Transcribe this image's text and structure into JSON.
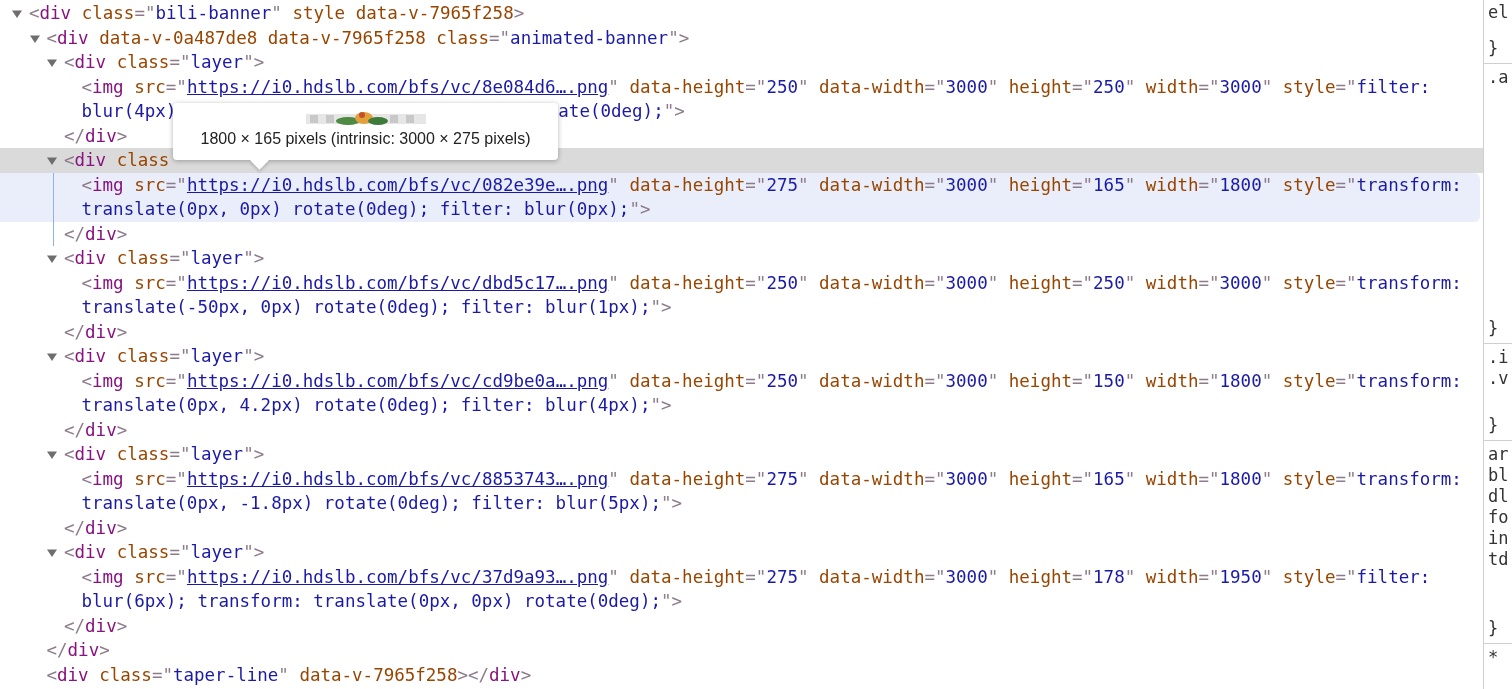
{
  "tree": [
    {
      "lines": [
        [
          {
            "kind": "punct",
            "text": "<"
          },
          {
            "kind": "tag",
            "text": "div"
          },
          {
            "kind": "attr",
            "text": " class"
          },
          {
            "kind": "punct",
            "text": "=\""
          },
          {
            "kind": "value",
            "text": "bili-banner"
          },
          {
            "kind": "punct",
            "text": "\""
          },
          {
            "kind": "attr",
            "text": " style data-v-7965f258"
          },
          {
            "kind": "punct",
            "text": ">"
          }
        ]
      ],
      "expanded": true,
      "selected": false,
      "hovered": false,
      "children": [
        {
          "lines": [
            [
              {
                "kind": "punct",
                "text": "<"
              },
              {
                "kind": "tag",
                "text": "div"
              },
              {
                "kind": "attr",
                "text": " data-v-0a487de8 data-v-7965f258 class"
              },
              {
                "kind": "punct",
                "text": "=\""
              },
              {
                "kind": "value",
                "text": "animated-banner"
              },
              {
                "kind": "punct",
                "text": "\">"
              }
            ]
          ],
          "expanded": true,
          "selected": false,
          "hovered": false,
          "children": [
            {
              "lines": [
                [
                  {
                    "kind": "punct",
                    "text": "<"
                  },
                  {
                    "kind": "tag",
                    "text": "div"
                  },
                  {
                    "kind": "attr",
                    "text": " class"
                  },
                  {
                    "kind": "punct",
                    "text": "=\""
                  },
                  {
                    "kind": "value",
                    "text": "layer"
                  },
                  {
                    "kind": "punct",
                    "text": "\">"
                  }
                ]
              ],
              "expanded": true,
              "selected": false,
              "hovered": false,
              "children": [
                {
                  "lines": [
                    [
                      {
                        "kind": "punct",
                        "text": "<"
                      },
                      {
                        "kind": "tag",
                        "text": "img"
                      },
                      {
                        "kind": "attr",
                        "text": " src"
                      },
                      {
                        "kind": "punct",
                        "text": "=\""
                      },
                      {
                        "kind": "link",
                        "text": "https://i0.hdslb.com/bfs/vc/8e084d6….png"
                      },
                      {
                        "kind": "punct",
                        "text": "\""
                      },
                      {
                        "kind": "attr",
                        "text": " data-height"
                      },
                      {
                        "kind": "punct",
                        "text": "=\""
                      },
                      {
                        "kind": "value",
                        "text": "250"
                      },
                      {
                        "kind": "punct",
                        "text": "\""
                      },
                      {
                        "kind": "attr",
                        "text": " data-width"
                      },
                      {
                        "kind": "punct",
                        "text": "=\""
                      },
                      {
                        "kind": "value",
                        "text": "3000"
                      },
                      {
                        "kind": "punct",
                        "text": "\""
                      },
                      {
                        "kind": "attr",
                        "text": " height"
                      },
                      {
                        "kind": "punct",
                        "text": "=\""
                      },
                      {
                        "kind": "value",
                        "text": "250"
                      },
                      {
                        "kind": "punct",
                        "text": "\""
                      },
                      {
                        "kind": "attr",
                        "text": " width"
                      },
                      {
                        "kind": "punct",
                        "text": "=\""
                      },
                      {
                        "kind": "value",
                        "text": "3000"
                      },
                      {
                        "kind": "punct",
                        "text": "\""
                      },
                      {
                        "kind": "attr",
                        "text": " style"
                      },
                      {
                        "kind": "punct",
                        "text": "=\""
                      },
                      {
                        "kind": "value",
                        "text": "filter:"
                      }
                    ],
                    [
                      {
                        "kind": "value",
                        "text": "blur(4px)"
                      },
                      {
                        "kind": "after-cover",
                        "text": "ate(0deg);"
                      },
                      {
                        "kind": "punct",
                        "text": "\">"
                      }
                    ]
                  ],
                  "selected": false,
                  "hovered": false
                }
              ],
              "close": [
                {
                  "kind": "punct",
                  "text": "</"
                },
                {
                  "kind": "tag",
                  "text": "div"
                },
                {
                  "kind": "punct",
                  "text": ">"
                }
              ]
            },
            {
              "lines": [
                [
                  {
                    "kind": "punct",
                    "text": "<"
                  },
                  {
                    "kind": "tag",
                    "text": "div"
                  },
                  {
                    "kind": "attr",
                    "text": " class"
                  }
                ]
              ],
              "expanded": true,
              "selected": true,
              "hovered": false,
              "children": [
                {
                  "lines": [
                    [
                      {
                        "kind": "punct",
                        "text": "<"
                      },
                      {
                        "kind": "tag",
                        "text": "img"
                      },
                      {
                        "kind": "attr",
                        "text": " src"
                      },
                      {
                        "kind": "punct",
                        "text": "=\""
                      },
                      {
                        "kind": "link",
                        "text": "https://i0.hdslb.com/bfs/vc/082e39e….png"
                      },
                      {
                        "kind": "punct",
                        "text": "\""
                      },
                      {
                        "kind": "attr",
                        "text": " data-height"
                      },
                      {
                        "kind": "punct",
                        "text": "=\""
                      },
                      {
                        "kind": "value",
                        "text": "275"
                      },
                      {
                        "kind": "punct",
                        "text": "\""
                      },
                      {
                        "kind": "attr",
                        "text": " data-width"
                      },
                      {
                        "kind": "punct",
                        "text": "=\""
                      },
                      {
                        "kind": "value",
                        "text": "3000"
                      },
                      {
                        "kind": "punct",
                        "text": "\""
                      },
                      {
                        "kind": "attr",
                        "text": " height"
                      },
                      {
                        "kind": "punct",
                        "text": "=\""
                      },
                      {
                        "kind": "value",
                        "text": "165"
                      },
                      {
                        "kind": "punct",
                        "text": "\""
                      },
                      {
                        "kind": "attr",
                        "text": " width"
                      },
                      {
                        "kind": "punct",
                        "text": "=\""
                      },
                      {
                        "kind": "value",
                        "text": "1800"
                      },
                      {
                        "kind": "punct",
                        "text": "\""
                      },
                      {
                        "kind": "attr",
                        "text": " style"
                      },
                      {
                        "kind": "punct",
                        "text": "=\""
                      },
                      {
                        "kind": "value",
                        "text": "transform:"
                      }
                    ],
                    [
                      {
                        "kind": "value",
                        "text": "translate(0px, 0px) rotate(0deg); filter: blur(0px);"
                      },
                      {
                        "kind": "punct",
                        "text": "\">"
                      }
                    ]
                  ],
                  "selected": false,
                  "hovered": true
                }
              ],
              "close": [
                {
                  "kind": "punct",
                  "text": "</"
                },
                {
                  "kind": "tag",
                  "text": "div"
                },
                {
                  "kind": "punct",
                  "text": ">"
                }
              ]
            },
            {
              "lines": [
                [
                  {
                    "kind": "punct",
                    "text": "<"
                  },
                  {
                    "kind": "tag",
                    "text": "div"
                  },
                  {
                    "kind": "attr",
                    "text": " class"
                  },
                  {
                    "kind": "punct",
                    "text": "=\""
                  },
                  {
                    "kind": "value",
                    "text": "layer"
                  },
                  {
                    "kind": "punct",
                    "text": "\">"
                  }
                ]
              ],
              "expanded": true,
              "selected": false,
              "hovered": false,
              "children": [
                {
                  "lines": [
                    [
                      {
                        "kind": "punct",
                        "text": "<"
                      },
                      {
                        "kind": "tag",
                        "text": "img"
                      },
                      {
                        "kind": "attr",
                        "text": " src"
                      },
                      {
                        "kind": "punct",
                        "text": "=\""
                      },
                      {
                        "kind": "link",
                        "text": "https://i0.hdslb.com/bfs/vc/dbd5c17….png"
                      },
                      {
                        "kind": "punct",
                        "text": "\""
                      },
                      {
                        "kind": "attr",
                        "text": " data-height"
                      },
                      {
                        "kind": "punct",
                        "text": "=\""
                      },
                      {
                        "kind": "value",
                        "text": "250"
                      },
                      {
                        "kind": "punct",
                        "text": "\""
                      },
                      {
                        "kind": "attr",
                        "text": " data-width"
                      },
                      {
                        "kind": "punct",
                        "text": "=\""
                      },
                      {
                        "kind": "value",
                        "text": "3000"
                      },
                      {
                        "kind": "punct",
                        "text": "\""
                      },
                      {
                        "kind": "attr",
                        "text": " height"
                      },
                      {
                        "kind": "punct",
                        "text": "=\""
                      },
                      {
                        "kind": "value",
                        "text": "250"
                      },
                      {
                        "kind": "punct",
                        "text": "\""
                      },
                      {
                        "kind": "attr",
                        "text": " width"
                      },
                      {
                        "kind": "punct",
                        "text": "=\""
                      },
                      {
                        "kind": "value",
                        "text": "3000"
                      },
                      {
                        "kind": "punct",
                        "text": "\""
                      },
                      {
                        "kind": "attr",
                        "text": " style"
                      },
                      {
                        "kind": "punct",
                        "text": "=\""
                      },
                      {
                        "kind": "value",
                        "text": "transform:"
                      }
                    ],
                    [
                      {
                        "kind": "value",
                        "text": "translate(-50px, 0px) rotate(0deg); filter: blur(1px);"
                      },
                      {
                        "kind": "punct",
                        "text": "\">"
                      }
                    ]
                  ],
                  "selected": false,
                  "hovered": false
                }
              ],
              "close": [
                {
                  "kind": "punct",
                  "text": "</"
                },
                {
                  "kind": "tag",
                  "text": "div"
                },
                {
                  "kind": "punct",
                  "text": ">"
                }
              ]
            },
            {
              "lines": [
                [
                  {
                    "kind": "punct",
                    "text": "<"
                  },
                  {
                    "kind": "tag",
                    "text": "div"
                  },
                  {
                    "kind": "attr",
                    "text": " class"
                  },
                  {
                    "kind": "punct",
                    "text": "=\""
                  },
                  {
                    "kind": "value",
                    "text": "layer"
                  },
                  {
                    "kind": "punct",
                    "text": "\">"
                  }
                ]
              ],
              "expanded": true,
              "selected": false,
              "hovered": false,
              "children": [
                {
                  "lines": [
                    [
                      {
                        "kind": "punct",
                        "text": "<"
                      },
                      {
                        "kind": "tag",
                        "text": "img"
                      },
                      {
                        "kind": "attr",
                        "text": " src"
                      },
                      {
                        "kind": "punct",
                        "text": "=\""
                      },
                      {
                        "kind": "link",
                        "text": "https://i0.hdslb.com/bfs/vc/cd9be0a….png"
                      },
                      {
                        "kind": "punct",
                        "text": "\""
                      },
                      {
                        "kind": "attr",
                        "text": " data-height"
                      },
                      {
                        "kind": "punct",
                        "text": "=\""
                      },
                      {
                        "kind": "value",
                        "text": "250"
                      },
                      {
                        "kind": "punct",
                        "text": "\""
                      },
                      {
                        "kind": "attr",
                        "text": " data-width"
                      },
                      {
                        "kind": "punct",
                        "text": "=\""
                      },
                      {
                        "kind": "value",
                        "text": "3000"
                      },
                      {
                        "kind": "punct",
                        "text": "\""
                      },
                      {
                        "kind": "attr",
                        "text": " height"
                      },
                      {
                        "kind": "punct",
                        "text": "=\""
                      },
                      {
                        "kind": "value",
                        "text": "150"
                      },
                      {
                        "kind": "punct",
                        "text": "\""
                      },
                      {
                        "kind": "attr",
                        "text": " width"
                      },
                      {
                        "kind": "punct",
                        "text": "=\""
                      },
                      {
                        "kind": "value",
                        "text": "1800"
                      },
                      {
                        "kind": "punct",
                        "text": "\""
                      },
                      {
                        "kind": "attr",
                        "text": " style"
                      },
                      {
                        "kind": "punct",
                        "text": "=\""
                      },
                      {
                        "kind": "value",
                        "text": "transform:"
                      }
                    ],
                    [
                      {
                        "kind": "value",
                        "text": "translate(0px, 4.2px) rotate(0deg); filter: blur(4px);"
                      },
                      {
                        "kind": "punct",
                        "text": "\">"
                      }
                    ]
                  ],
                  "selected": false,
                  "hovered": false
                }
              ],
              "close": [
                {
                  "kind": "punct",
                  "text": "</"
                },
                {
                  "kind": "tag",
                  "text": "div"
                },
                {
                  "kind": "punct",
                  "text": ">"
                }
              ]
            },
            {
              "lines": [
                [
                  {
                    "kind": "punct",
                    "text": "<"
                  },
                  {
                    "kind": "tag",
                    "text": "div"
                  },
                  {
                    "kind": "attr",
                    "text": " class"
                  },
                  {
                    "kind": "punct",
                    "text": "=\""
                  },
                  {
                    "kind": "value",
                    "text": "layer"
                  },
                  {
                    "kind": "punct",
                    "text": "\">"
                  }
                ]
              ],
              "expanded": true,
              "selected": false,
              "hovered": false,
              "children": [
                {
                  "lines": [
                    [
                      {
                        "kind": "punct",
                        "text": "<"
                      },
                      {
                        "kind": "tag",
                        "text": "img"
                      },
                      {
                        "kind": "attr",
                        "text": " src"
                      },
                      {
                        "kind": "punct",
                        "text": "=\""
                      },
                      {
                        "kind": "link",
                        "text": "https://i0.hdslb.com/bfs/vc/8853743….png"
                      },
                      {
                        "kind": "punct",
                        "text": "\""
                      },
                      {
                        "kind": "attr",
                        "text": " data-height"
                      },
                      {
                        "kind": "punct",
                        "text": "=\""
                      },
                      {
                        "kind": "value",
                        "text": "275"
                      },
                      {
                        "kind": "punct",
                        "text": "\""
                      },
                      {
                        "kind": "attr",
                        "text": " data-width"
                      },
                      {
                        "kind": "punct",
                        "text": "=\""
                      },
                      {
                        "kind": "value",
                        "text": "3000"
                      },
                      {
                        "kind": "punct",
                        "text": "\""
                      },
                      {
                        "kind": "attr",
                        "text": " height"
                      },
                      {
                        "kind": "punct",
                        "text": "=\""
                      },
                      {
                        "kind": "value",
                        "text": "165"
                      },
                      {
                        "kind": "punct",
                        "text": "\""
                      },
                      {
                        "kind": "attr",
                        "text": " width"
                      },
                      {
                        "kind": "punct",
                        "text": "=\""
                      },
                      {
                        "kind": "value",
                        "text": "1800"
                      },
                      {
                        "kind": "punct",
                        "text": "\""
                      },
                      {
                        "kind": "attr",
                        "text": " style"
                      },
                      {
                        "kind": "punct",
                        "text": "=\""
                      },
                      {
                        "kind": "value",
                        "text": "transform:"
                      }
                    ],
                    [
                      {
                        "kind": "value",
                        "text": "translate(0px, -1.8px) rotate(0deg); filter: blur(5px);"
                      },
                      {
                        "kind": "punct",
                        "text": "\">"
                      }
                    ]
                  ],
                  "selected": false,
                  "hovered": false
                }
              ],
              "close": [
                {
                  "kind": "punct",
                  "text": "</"
                },
                {
                  "kind": "tag",
                  "text": "div"
                },
                {
                  "kind": "punct",
                  "text": ">"
                }
              ]
            },
            {
              "lines": [
                [
                  {
                    "kind": "punct",
                    "text": "<"
                  },
                  {
                    "kind": "tag",
                    "text": "div"
                  },
                  {
                    "kind": "attr",
                    "text": " class"
                  },
                  {
                    "kind": "punct",
                    "text": "=\""
                  },
                  {
                    "kind": "value",
                    "text": "layer"
                  },
                  {
                    "kind": "punct",
                    "text": "\">"
                  }
                ]
              ],
              "expanded": true,
              "selected": false,
              "hovered": false,
              "children": [
                {
                  "lines": [
                    [
                      {
                        "kind": "punct",
                        "text": "<"
                      },
                      {
                        "kind": "tag",
                        "text": "img"
                      },
                      {
                        "kind": "attr",
                        "text": " src"
                      },
                      {
                        "kind": "punct",
                        "text": "=\""
                      },
                      {
                        "kind": "link",
                        "text": "https://i0.hdslb.com/bfs/vc/37d9a93….png"
                      },
                      {
                        "kind": "punct",
                        "text": "\""
                      },
                      {
                        "kind": "attr",
                        "text": " data-height"
                      },
                      {
                        "kind": "punct",
                        "text": "=\""
                      },
                      {
                        "kind": "value",
                        "text": "275"
                      },
                      {
                        "kind": "punct",
                        "text": "\""
                      },
                      {
                        "kind": "attr",
                        "text": " data-width"
                      },
                      {
                        "kind": "punct",
                        "text": "=\""
                      },
                      {
                        "kind": "value",
                        "text": "3000"
                      },
                      {
                        "kind": "punct",
                        "text": "\""
                      },
                      {
                        "kind": "attr",
                        "text": " height"
                      },
                      {
                        "kind": "punct",
                        "text": "=\""
                      },
                      {
                        "kind": "value",
                        "text": "178"
                      },
                      {
                        "kind": "punct",
                        "text": "\""
                      },
                      {
                        "kind": "attr",
                        "text": " width"
                      },
                      {
                        "kind": "punct",
                        "text": "=\""
                      },
                      {
                        "kind": "value",
                        "text": "1950"
                      },
                      {
                        "kind": "punct",
                        "text": "\""
                      },
                      {
                        "kind": "attr",
                        "text": " style"
                      },
                      {
                        "kind": "punct",
                        "text": "=\""
                      },
                      {
                        "kind": "value",
                        "text": "filter:"
                      }
                    ],
                    [
                      {
                        "kind": "value",
                        "text": "blur(6px); transform: translate(0px, 0px) rotate(0deg);"
                      },
                      {
                        "kind": "punct",
                        "text": "\">"
                      }
                    ]
                  ],
                  "selected": false,
                  "hovered": false
                }
              ],
              "close": [
                {
                  "kind": "punct",
                  "text": "</"
                },
                {
                  "kind": "tag",
                  "text": "div"
                },
                {
                  "kind": "punct",
                  "text": ">"
                }
              ]
            }
          ],
          "close": [
            {
              "kind": "punct",
              "text": "</"
            },
            {
              "kind": "tag",
              "text": "div"
            },
            {
              "kind": "punct",
              "text": ">"
            }
          ]
        },
        {
          "lines": [
            [
              {
                "kind": "punct",
                "text": "<"
              },
              {
                "kind": "tag",
                "text": "div"
              },
              {
                "kind": "attr",
                "text": " class"
              },
              {
                "kind": "punct",
                "text": "=\""
              },
              {
                "kind": "value",
                "text": "taper-line"
              },
              {
                "kind": "punct",
                "text": "\""
              },
              {
                "kind": "attr",
                "text": " data-v-7965f258"
              },
              {
                "kind": "punct",
                "text": "></"
              },
              {
                "kind": "tag",
                "text": "div"
              },
              {
                "kind": "punct",
                "text": ">"
              }
            ]
          ],
          "selected": false,
          "hovered": false
        }
      ]
    }
  ],
  "tooltip": {
    "text": "1800 × 165 pixels (intrinsic: 3000 × 275 pixels)"
  },
  "styles_sidebar": [
    {
      "lines": [
        "el"
      ],
      "close": "}"
    },
    {
      "lines": [
        ".a"
      ],
      "close": "}"
    },
    {
      "lines": [
        ".i",
        ".v"
      ],
      "close": "}"
    },
    {
      "lines": [
        "ar",
        "bl",
        "dl",
        "fo",
        "in",
        "td"
      ],
      "close": "}"
    },
    {
      "lines": [
        "*"
      ]
    }
  ]
}
